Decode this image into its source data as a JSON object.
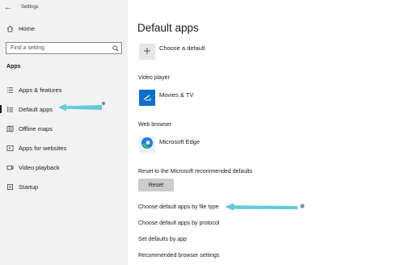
{
  "window": {
    "title": "Settings",
    "back_glyph": "←"
  },
  "sidebar": {
    "home_label": "Home",
    "search_placeholder": "Find a setting",
    "section_label": "Apps",
    "items": [
      {
        "label": "Apps & features",
        "icon": "apps-list-icon"
      },
      {
        "label": "Default apps",
        "icon": "default-apps-icon",
        "selected": true
      },
      {
        "label": "Offline maps",
        "icon": "map-icon"
      },
      {
        "label": "Apps for websites",
        "icon": "website-icon"
      },
      {
        "label": "Video playback",
        "icon": "video-icon"
      },
      {
        "label": "Startup",
        "icon": "startup-icon"
      }
    ]
  },
  "main": {
    "title": "Default apps",
    "choose_default_label": "Choose a default",
    "video_player": {
      "heading": "Video player",
      "app_name": "Movies & TV"
    },
    "web_browser": {
      "heading": "Web browser",
      "app_name": "Microsoft Edge"
    },
    "reset": {
      "heading": "Reset to the Microsoft recommended defaults",
      "button_label": "Reset"
    },
    "links": [
      "Choose default apps by file type",
      "Choose default apps by protocol",
      "Set defaults by app",
      "Recommended browser settings"
    ]
  },
  "colors": {
    "sidebar_bg": "#f2f2f2",
    "movies_tile": "#0e6fc7",
    "edge_blue": "#1f7fd4",
    "edge_green": "#3fbf6b",
    "annotation_arrow": "#5bc8d6",
    "reset_button_bg": "#cccccc"
  }
}
